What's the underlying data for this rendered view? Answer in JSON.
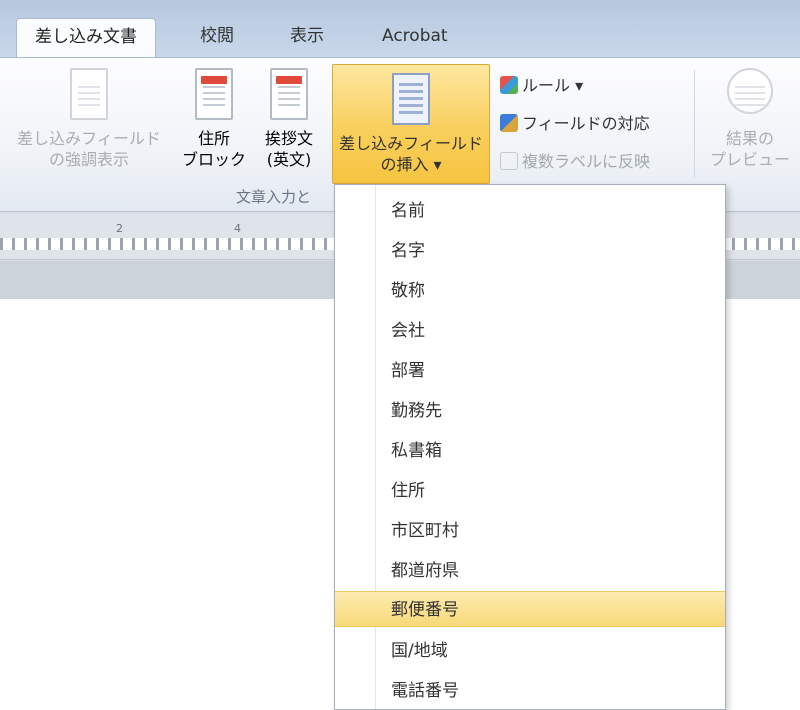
{
  "tabs": [
    {
      "label": "差し込み文書",
      "active": true
    },
    {
      "label": "校閲",
      "active": false
    },
    {
      "label": "表示",
      "active": false
    },
    {
      "label": "Acrobat",
      "active": false
    }
  ],
  "ribbon": {
    "highlight_fields": {
      "line1": "差し込みフィールド",
      "line2": "の強調表示"
    },
    "address_block": {
      "line1": "住所",
      "line2": "ブロック"
    },
    "greeting_line": {
      "line1": "挨拶文",
      "line2": "(英文)"
    },
    "insert_field": {
      "line1": "差し込みフィールド",
      "line2": "の挿入 ▾"
    },
    "rules": "ルール ▾",
    "match_fields": "フィールドの対応",
    "update_labels": "複数ラベルに反映",
    "preview_results": {
      "line1": "結果の",
      "line2": "プレビュー"
    },
    "group_label": "文章入力と"
  },
  "ruler_ticks": [
    "2",
    "4"
  ],
  "dropdown": {
    "items": [
      {
        "label": "名前"
      },
      {
        "label": "名字"
      },
      {
        "label": "敬称"
      },
      {
        "label": "会社"
      },
      {
        "label": "部署"
      },
      {
        "label": "勤務先"
      },
      {
        "label": "私書箱"
      },
      {
        "label": "住所"
      },
      {
        "label": "市区町村"
      },
      {
        "label": "都道府県"
      },
      {
        "label": "郵便番号",
        "hover": true
      },
      {
        "label": "国/地域"
      },
      {
        "label": "電話番号"
      }
    ]
  },
  "colors": {
    "accent_hover": "#f8d97a",
    "ribbon_tab_border": "#a9bbd2"
  }
}
